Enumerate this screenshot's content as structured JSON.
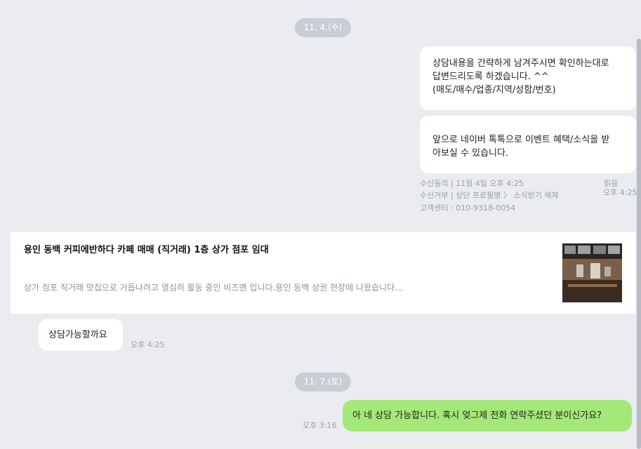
{
  "dates": [
    "11. 4.(수)",
    "11. 7.(토)"
  ],
  "bot_messages": {
    "line1": "상담내용을 간략하게 남겨주시면 확인하는대로",
    "line2": "답변드리도록 하겠습니다. ^^",
    "line3": "(매도/매수/업종/지역/성함/번호)",
    "msg2_line1": "앞으로 네이버 톡톡으로 이벤트 혜택/소식을 받",
    "msg2_line2": "아보실 수 있습니다."
  },
  "receipt": {
    "consent": "수신동의 | 11월 4일 오후 4:25",
    "reject_prefix": "수신거부 | 상단 프로필명",
    "reject_arrow": "〉",
    "reject_suffix": "소식받기 해제",
    "support": "고객센터 : 010-9318-0054",
    "read": "읽음",
    "time": "오후 4:25"
  },
  "card": {
    "title": "용인 동백 커피에반하다 카페 매매 (직거래) 1층 상가 점포 임대",
    "description": "상가 점포 직거래 맛집으로 거듭나려고 열심히 활동 중인 비즈맨 입니다.용인 동백 상권 현장에 나왔습니다..."
  },
  "incoming": {
    "text": "상담가능할까요",
    "time": "오후 4:25"
  },
  "outgoing": {
    "text": "아 네 상담 가능합니다. 혹시 엊그제 전화 연락주셨던 분이신가요?",
    "time": "오후 3:16"
  },
  "colors": {
    "background": "#eaecf0",
    "my_bubble": "#a3e878",
    "date_chip": "#c9ced5"
  },
  "icons": {
    "thumbnail": "cafe-photo-thumbnail"
  }
}
